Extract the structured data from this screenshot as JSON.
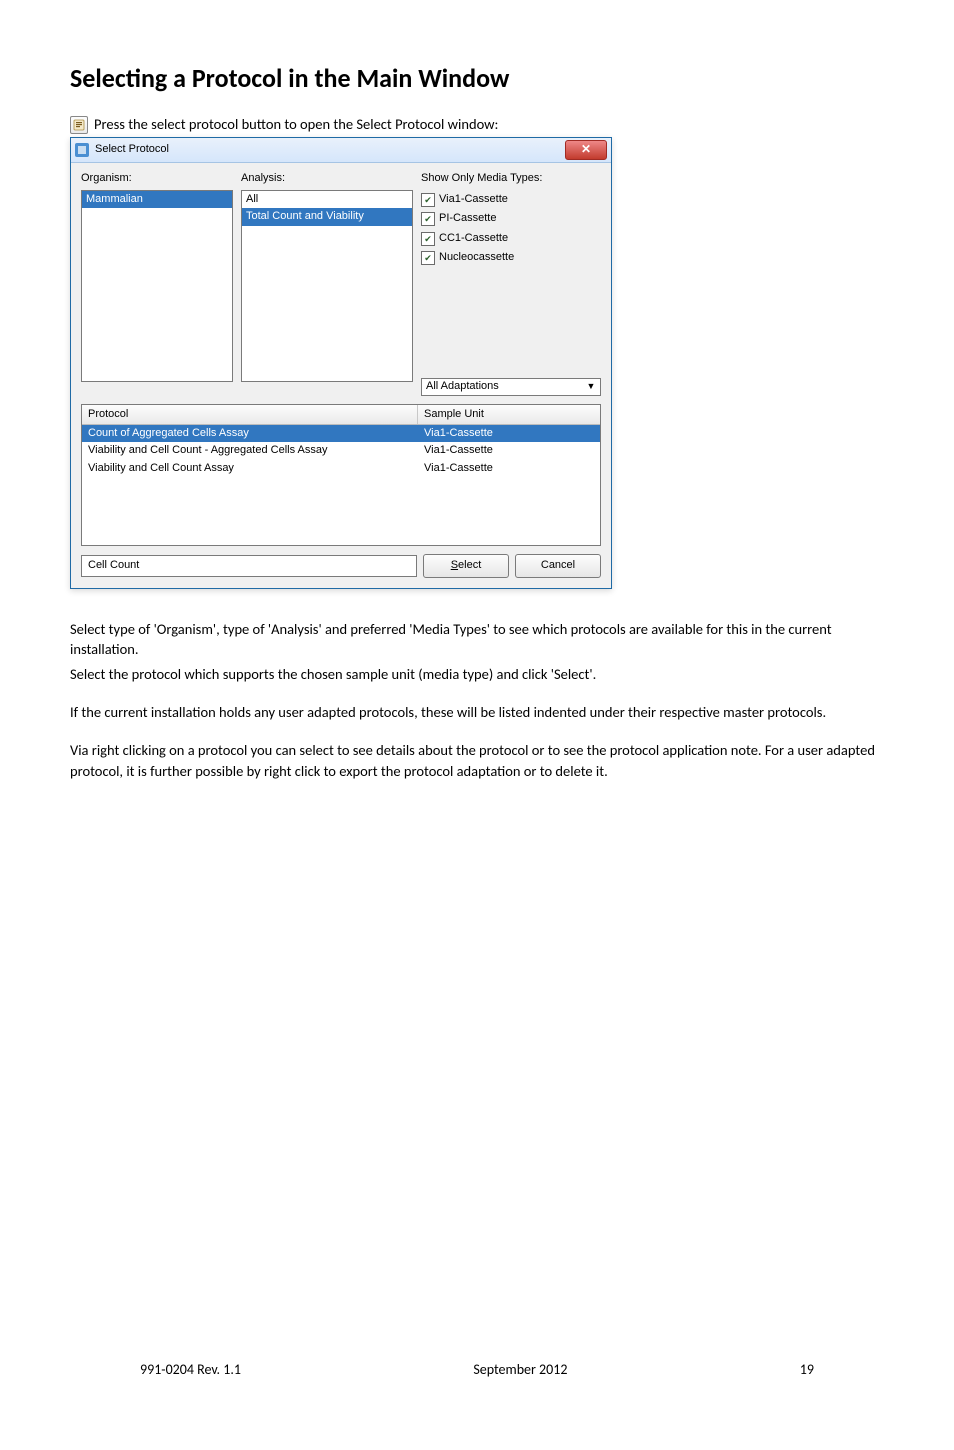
{
  "heading": "Selecting a Protocol in the Main Window",
  "intro": "Press the select protocol button to open the Select Protocol window:",
  "dialog": {
    "title": "Select Protocol",
    "labels": {
      "organism": "Organism:",
      "analysis": "Analysis:",
      "media": "Show Only Media Types:"
    },
    "organism_items": [
      "Mammalian"
    ],
    "analysis_items": [
      "All",
      "Total Count and Viability"
    ],
    "media_checks": [
      {
        "label": "Via1-Cassette",
        "checked": true
      },
      {
        "label": "PI-Cassette",
        "checked": true
      },
      {
        "label": "CC1-Cassette",
        "checked": true
      },
      {
        "label": "Nucleocassette",
        "checked": true
      }
    ],
    "adaptations": "All Adaptations",
    "proto_header_protocol": "Protocol",
    "proto_header_sample": "Sample Unit",
    "proto_rows": [
      {
        "protocol": "Count of Aggregated Cells Assay",
        "sample": "Via1-Cassette",
        "selected": true
      },
      {
        "protocol": "Viability and Cell Count - Aggregated Cells Assay",
        "sample": "Via1-Cassette",
        "selected": false
      },
      {
        "protocol": "Viability and Cell Count Assay",
        "sample": "Via1-Cassette",
        "selected": false
      }
    ],
    "status": "Cell Count",
    "select_btn": "Select",
    "cancel_btn": "Cancel"
  },
  "para1a": "Select type of 'Organism', type of 'Analysis' and preferred 'Media Types' to see which protocols are available for this in the current installation.",
  "para1b": "Select the protocol which supports the chosen sample unit (media type) and click 'Select'.",
  "para2": "If the current installation holds any user adapted protocols, these will be listed indented under their respective master protocols.",
  "para3": "Via right clicking on a protocol you can select to see details about the protocol or to see the protocol application note. For a user adapted protocol, it is further possible by right click to export the protocol adaptation or to delete it.",
  "footer_left": "991-0204 Rev. 1.1",
  "footer_center": "September 2012",
  "footer_right": "19"
}
